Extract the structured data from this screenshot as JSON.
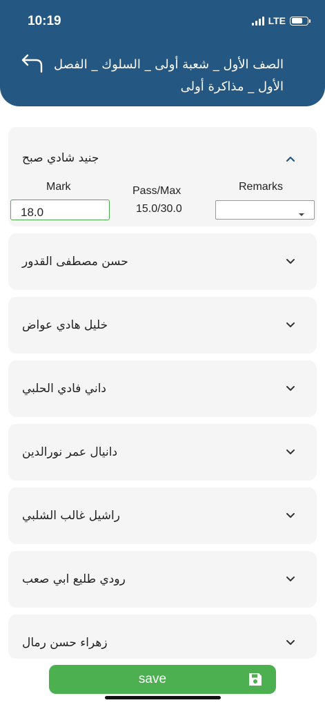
{
  "status_bar": {
    "time": "10:19",
    "network": "LTE"
  },
  "header": {
    "title": "الصف الأول _ شعبة  أولى _ السلوك _ الفصل الأول _ مذاكرة أولى",
    "back_icon": "back-arrow-icon"
  },
  "expanded_item": {
    "name": "جنيد شادي صبح",
    "mark_label": "Mark",
    "pass_max_label": "Pass/Max",
    "remarks_label": "Remarks",
    "mark_value": "18.0",
    "pass_max_value": "15.0/30.0",
    "remarks_value": ""
  },
  "students": [
    {
      "name": "حسن مصطفى القدور"
    },
    {
      "name": "خليل هادي عواض"
    },
    {
      "name": "داني فادي الحلبي"
    },
    {
      "name": "دانيال عمر نورالدين"
    },
    {
      "name": "راشيل غالب الشلبي"
    },
    {
      "name": "رودي طليع ابي صعب"
    },
    {
      "name": "زهراء حسن رمال"
    }
  ],
  "save": {
    "label": "save",
    "icon": "floppy-disk-icon"
  },
  "colors": {
    "header": "#245781",
    "accent": "#4caf50",
    "card": "#f5f5f5"
  }
}
